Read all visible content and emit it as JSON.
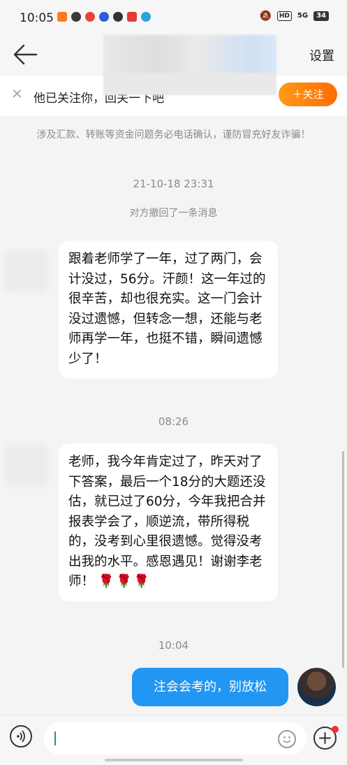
{
  "status_bar": {
    "time": "10:05",
    "net_label": "5G",
    "hd_label": "HD",
    "battery": "34"
  },
  "header": {
    "settings_label": "设置"
  },
  "follow_bar": {
    "text": "他已关注你，回关一下吧",
    "follow_button": "＋关注"
  },
  "chat": {
    "security_notice": "涉及汇款、转账等资金问题务必电话确认，谨防冒充好友诈骗！",
    "time_1": "21-10-18 23:31",
    "recall_notice": "对方撤回了一条消息",
    "message_1": "跟着老师学了一年，过了两门，会计没过，56分。汗颜！这一年过的很辛苦，却也很充实。这一门会计没过遗憾，但转念一想，还能与老师再学一年，也挺不错，瞬间遗憾少了！",
    "time_2": "08:26",
    "message_2": "老师，我今年肯定过了，昨天对了下答案，最后一个18分的大题还没估，就已过了60分，今年我把合并报表学会了，顺逆流，带所得税的，没考到心里很遗憾。觉得没考出我的水平。感恩遇见！谢谢李老师！",
    "message_2_emoji": "🌹🌹🌹",
    "time_3": "10:04",
    "message_3": "注会会考的，别放松"
  },
  "input_bar": {
    "value": "",
    "placeholder": ""
  }
}
